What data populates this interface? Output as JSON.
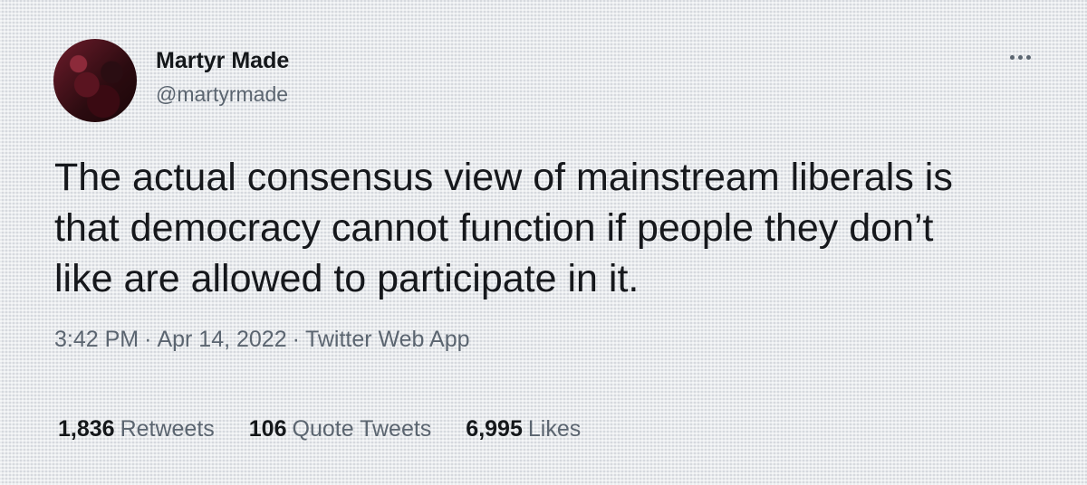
{
  "author": {
    "name": "Martyr Made",
    "handle": "@martyrmade"
  },
  "tweet": {
    "lines": [
      "The actual consensus view of mainstream liberals is",
      "that democracy cannot function if people they don’t",
      "like are allowed to participate in it."
    ],
    "time": "3:42 PM",
    "date": "Apr 14, 2022",
    "source": "Twitter Web App",
    "separator": "·"
  },
  "stats": {
    "retweets": {
      "count": "1,836",
      "label": "Retweets"
    },
    "quote_tweets": {
      "count": "106",
      "label": "Quote Tweets"
    },
    "likes": {
      "count": "6,995",
      "label": "Likes"
    }
  },
  "icons": {
    "more": "more-horizontal-icon"
  }
}
